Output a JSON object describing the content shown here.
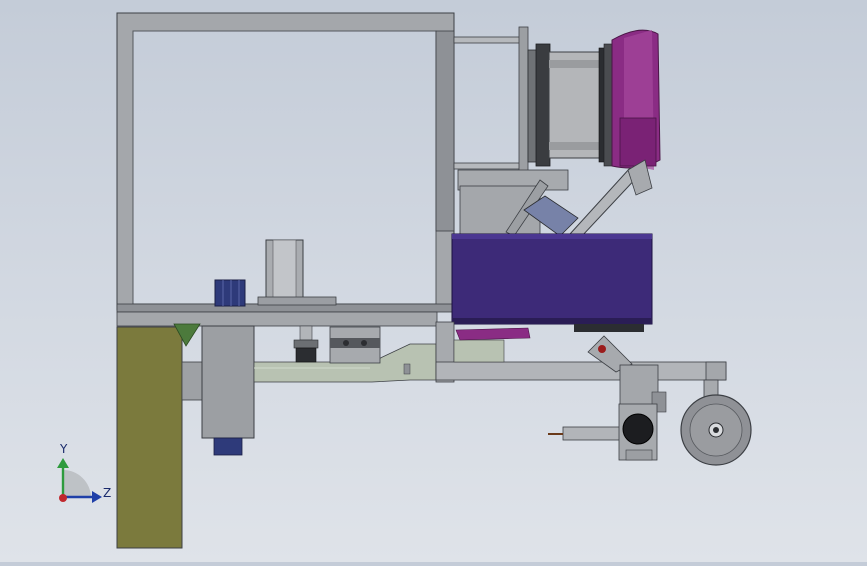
{
  "view": {
    "type": "CAD assembly side view",
    "background_top": "#c4ccd8",
    "background_bottom": "#dfe3e9"
  },
  "triad": {
    "y_label": "Y",
    "z_label": "Z",
    "y_color": "#2e9b3e",
    "z_color": "#1f3fa8",
    "origin_color": "#c0282d"
  },
  "colors": {
    "frame": "#9b9ea3",
    "frame_edge": "#3c3f44",
    "purple_box": "#3d2a78",
    "drum": "#a8aaad",
    "drum_cap": "#8a2c84",
    "olive_plate": "#7b7a3d",
    "pipe": "#b8c2b2",
    "wheel": "#8f9196",
    "dark": "#2b2d31",
    "blue_motor": "#2e3a7a",
    "red_accent": "#9b1c1c"
  }
}
